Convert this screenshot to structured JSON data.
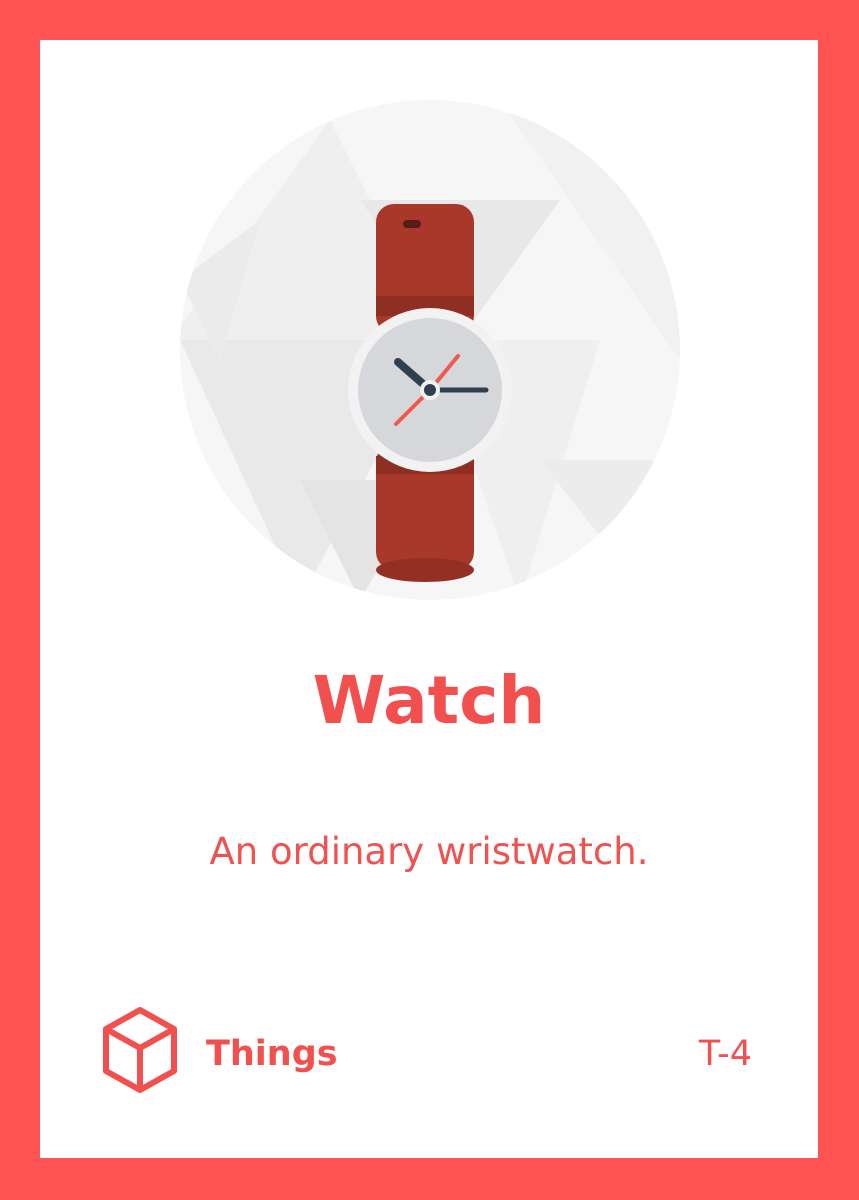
{
  "card": {
    "title": "Watch",
    "description": "An ordinary wristwatch.",
    "category": "Things",
    "code": "T-4",
    "icons": {
      "illustration": "wristwatch-icon",
      "category": "cube-icon"
    },
    "colors": {
      "brand": "#ff5353",
      "accent_text": "#f2504f",
      "watch_strap": "#a8382a",
      "watch_face": "#d5d7da",
      "watch_case": "#f2f2f2",
      "watch_hand_dark": "#2f4150",
      "watch_hand_second": "#ef5a4f"
    }
  }
}
